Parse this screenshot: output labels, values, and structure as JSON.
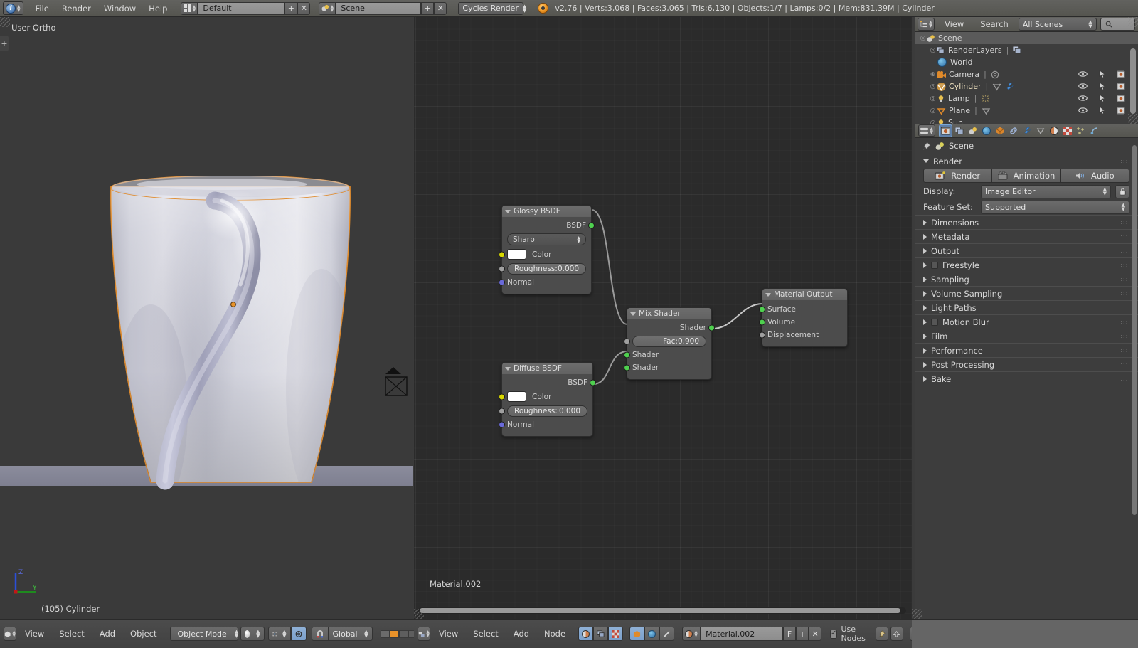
{
  "app": {
    "name": "Blender",
    "version_status": "v2.76 | Verts:3,068 | Faces:3,065 | Tris:6,130 | Objects:1/7 | Lamps:0/2 | Mem:831.39M | Cylinder"
  },
  "topbar": {
    "menus": [
      "File",
      "Render",
      "Window",
      "Help"
    ],
    "screen_layout": "Default",
    "scene_name": "Scene",
    "render_engine": "Cycles Render",
    "add_label": "+",
    "remove_label": "✕",
    "editor_icon": "info-editor-icon",
    "layout_icon": "screen-layout-icon",
    "scene_icon": "scene-icon"
  },
  "viewport": {
    "view_label": "User Ortho",
    "object_label": "(105) Cylinder",
    "axis_z": "Z",
    "axis_y": "Y",
    "panel_toggle": "+",
    "header": {
      "editor_icon": "3d-view-editor-icon",
      "menus": [
        "View",
        "Select",
        "Add",
        "Object"
      ],
      "mode": "Object Mode",
      "mode_icon": "object-mode-icon",
      "shading": "solid-shading-icon",
      "pivot": "pivot-icon",
      "snap_icon": "snap-magnet-icon",
      "manipulator_icon": "manipulator-icon",
      "transform_orientation": "Global",
      "layers_label": "scene-layers",
      "proportional_icon": "proportional-edit-icon"
    }
  },
  "node_editor": {
    "material_label": "Material.002",
    "header": {
      "editor_icon": "node-editor-icon",
      "menus": [
        "View",
        "Select",
        "Add",
        "Node"
      ],
      "shader_type_icons": [
        "material-shader-icon",
        "world-shader-icon",
        "texture-shader-icon"
      ],
      "context_icons": [
        "object-icon",
        "world-icon",
        "linestyle-icon"
      ],
      "datablock_icon": "material-datablock-icon",
      "datablock_name": "Material.002",
      "fake_user_label": "F",
      "new_label": "+",
      "unlink_label": "✕",
      "use_nodes_label": "Use Nodes",
      "use_nodes_checked": true,
      "pin_icon": "pin-icon",
      "go-up-icon": "go-to-parent-icon",
      "snap_icons": [
        "snap-node-icon",
        "snap-off-icon"
      ],
      "snap_mode_icon": "snap-grid-icon",
      "overlay_icon": "backdrop-icon"
    },
    "nodes": [
      {
        "id": "glossy",
        "title": "Glossy BSDF",
        "outputs": [
          {
            "label": "BSDF",
            "color": "green"
          }
        ],
        "distribution": "Sharp",
        "color_label": "Color",
        "color_value": "#ffffff",
        "roughness_label": "Roughness:",
        "roughness_value": "0.000",
        "normal_label": "Normal"
      },
      {
        "id": "diffuse",
        "title": "Diffuse BSDF",
        "outputs": [
          {
            "label": "BSDF",
            "color": "green"
          }
        ],
        "color_label": "Color",
        "color_value": "#ffffff",
        "roughness_label": "Roughness:",
        "roughness_value": "0.000",
        "normal_label": "Normal"
      },
      {
        "id": "mix",
        "title": "Mix Shader",
        "outputs": [
          {
            "label": "Shader",
            "color": "green"
          }
        ],
        "fac_label": "Fac:",
        "fac_value": "0.900",
        "inputs": [
          {
            "label": "Shader",
            "color": "green"
          },
          {
            "label": "Shader",
            "color": "green"
          }
        ]
      },
      {
        "id": "output",
        "title": "Material Output",
        "inputs": [
          {
            "label": "Surface",
            "color": "green"
          },
          {
            "label": "Volume",
            "color": "green"
          },
          {
            "label": "Displacement",
            "color": "grey"
          }
        ]
      }
    ]
  },
  "outliner": {
    "header": {
      "editor_icon": "outliner-editor-icon",
      "menus": [
        "View",
        "Search"
      ],
      "display_mode": "All Scenes",
      "filter_icon": "search-icon"
    },
    "rows": [
      {
        "label": "Scene",
        "icon": "scene-icon",
        "indent": 0,
        "expand": "minus",
        "selected": true,
        "toggles": false
      },
      {
        "label": "RenderLayers",
        "icon": "renderlayers-icon",
        "indent": 1,
        "expand": "dot",
        "selected": false,
        "toggles": false,
        "extra_icon": "renderlayer-data-icon"
      },
      {
        "label": "World",
        "icon": "world-icon",
        "indent": 1,
        "expand": "none",
        "selected": false,
        "toggles": false
      },
      {
        "label": "Camera",
        "icon": "camera-icon",
        "indent": 1,
        "expand": "plus",
        "selected": false,
        "toggles": true,
        "extra_icon": "camera-data-icon"
      },
      {
        "label": "Cylinder",
        "icon": "mesh-object-icon",
        "indent": 1,
        "expand": "dot",
        "selected": false,
        "toggles": true,
        "extra_icon": "mesh-data-icon",
        "extra_icon2": "modifier-wrench-icon",
        "active": true
      },
      {
        "label": "Lamp",
        "icon": "lamp-icon",
        "indent": 1,
        "expand": "dot",
        "selected": false,
        "toggles": true,
        "extra_icon": "lamp-data-icon"
      },
      {
        "label": "Plane",
        "icon": "mesh-object-icon",
        "indent": 1,
        "expand": "dot",
        "selected": false,
        "toggles": true,
        "extra_icon": "mesh-data-icon"
      },
      {
        "label": "Sun",
        "icon": "lamp-icon",
        "indent": 1,
        "expand": "dot",
        "selected": false,
        "toggles": true,
        "extra_icon": "lamp-data-icon"
      }
    ],
    "toggle_icons": [
      "eye-icon",
      "cursor-arrow-icon",
      "camera-render-icon"
    ]
  },
  "properties": {
    "tabs": [
      {
        "name": "render-tab",
        "icon": "camera-back-icon",
        "active": true
      },
      {
        "name": "render-layers-tab",
        "icon": "images-icon",
        "active": false
      },
      {
        "name": "scene-tab",
        "icon": "scene-props-icon",
        "active": false
      },
      {
        "name": "world-tab",
        "icon": "world-globe-icon",
        "active": false
      },
      {
        "name": "object-tab",
        "icon": "orange-cube-icon",
        "active": false
      },
      {
        "name": "constraints-tab",
        "icon": "chain-link-icon",
        "active": false
      },
      {
        "name": "modifiers-tab",
        "icon": "wrench-icon",
        "active": false
      },
      {
        "name": "data-tab",
        "icon": "mesh-triangle-icon",
        "active": false
      },
      {
        "name": "material-tab",
        "icon": "material-ball-icon",
        "active": false
      },
      {
        "name": "texture-tab",
        "icon": "checker-icon",
        "active": false
      },
      {
        "name": "particles-tab",
        "icon": "particles-icon",
        "active": false
      },
      {
        "name": "physics-tab",
        "icon": "physics-icon",
        "active": false
      }
    ],
    "breadcrumb": {
      "pin_icon": "pin-icon",
      "scene_icon": "scene-icon",
      "scene_name": "Scene"
    },
    "render_panel": {
      "title": "Render",
      "open": true,
      "buttons": [
        {
          "label": "Render",
          "icon": "render-camera-icon"
        },
        {
          "label": "Animation",
          "icon": "render-animation-icon"
        },
        {
          "label": "Audio",
          "icon": "render-audio-icon"
        }
      ],
      "display_label": "Display:",
      "display_value": "Image Editor",
      "display_lock_icon": "lock-icon",
      "feature_set_label": "Feature Set:",
      "feature_set_value": "Supported"
    },
    "panels": [
      {
        "title": "Dimensions",
        "open": false,
        "checkbox": false
      },
      {
        "title": "Metadata",
        "open": false,
        "checkbox": false
      },
      {
        "title": "Output",
        "open": false,
        "checkbox": false
      },
      {
        "title": "Freestyle",
        "open": false,
        "checkbox": true
      },
      {
        "title": "Sampling",
        "open": false,
        "checkbox": false
      },
      {
        "title": "Volume Sampling",
        "open": false,
        "checkbox": false
      },
      {
        "title": "Light Paths",
        "open": false,
        "checkbox": false
      },
      {
        "title": "Motion Blur",
        "open": false,
        "checkbox": true
      },
      {
        "title": "Film",
        "open": false,
        "checkbox": false
      },
      {
        "title": "Performance",
        "open": false,
        "checkbox": false
      },
      {
        "title": "Post Processing",
        "open": false,
        "checkbox": false
      },
      {
        "title": "Bake",
        "open": false,
        "checkbox": false
      }
    ]
  },
  "colors": {
    "header_bg": "#5b5b56",
    "panel_bg": "#3d3d3d",
    "node_bg": "#4c4c4c",
    "node_editor_bg": "#2b2b2b",
    "viewport_bg": "#3a3a3a",
    "accent_orange": "#e8922a",
    "selection_outline": "#e08a2a",
    "socket_green": "#4fd04f",
    "socket_yellow": "#d9d900",
    "socket_grey": "#a0a0a0",
    "socket_blue": "#6a6ad9",
    "active_tab_blue": "#5e7fa8"
  }
}
